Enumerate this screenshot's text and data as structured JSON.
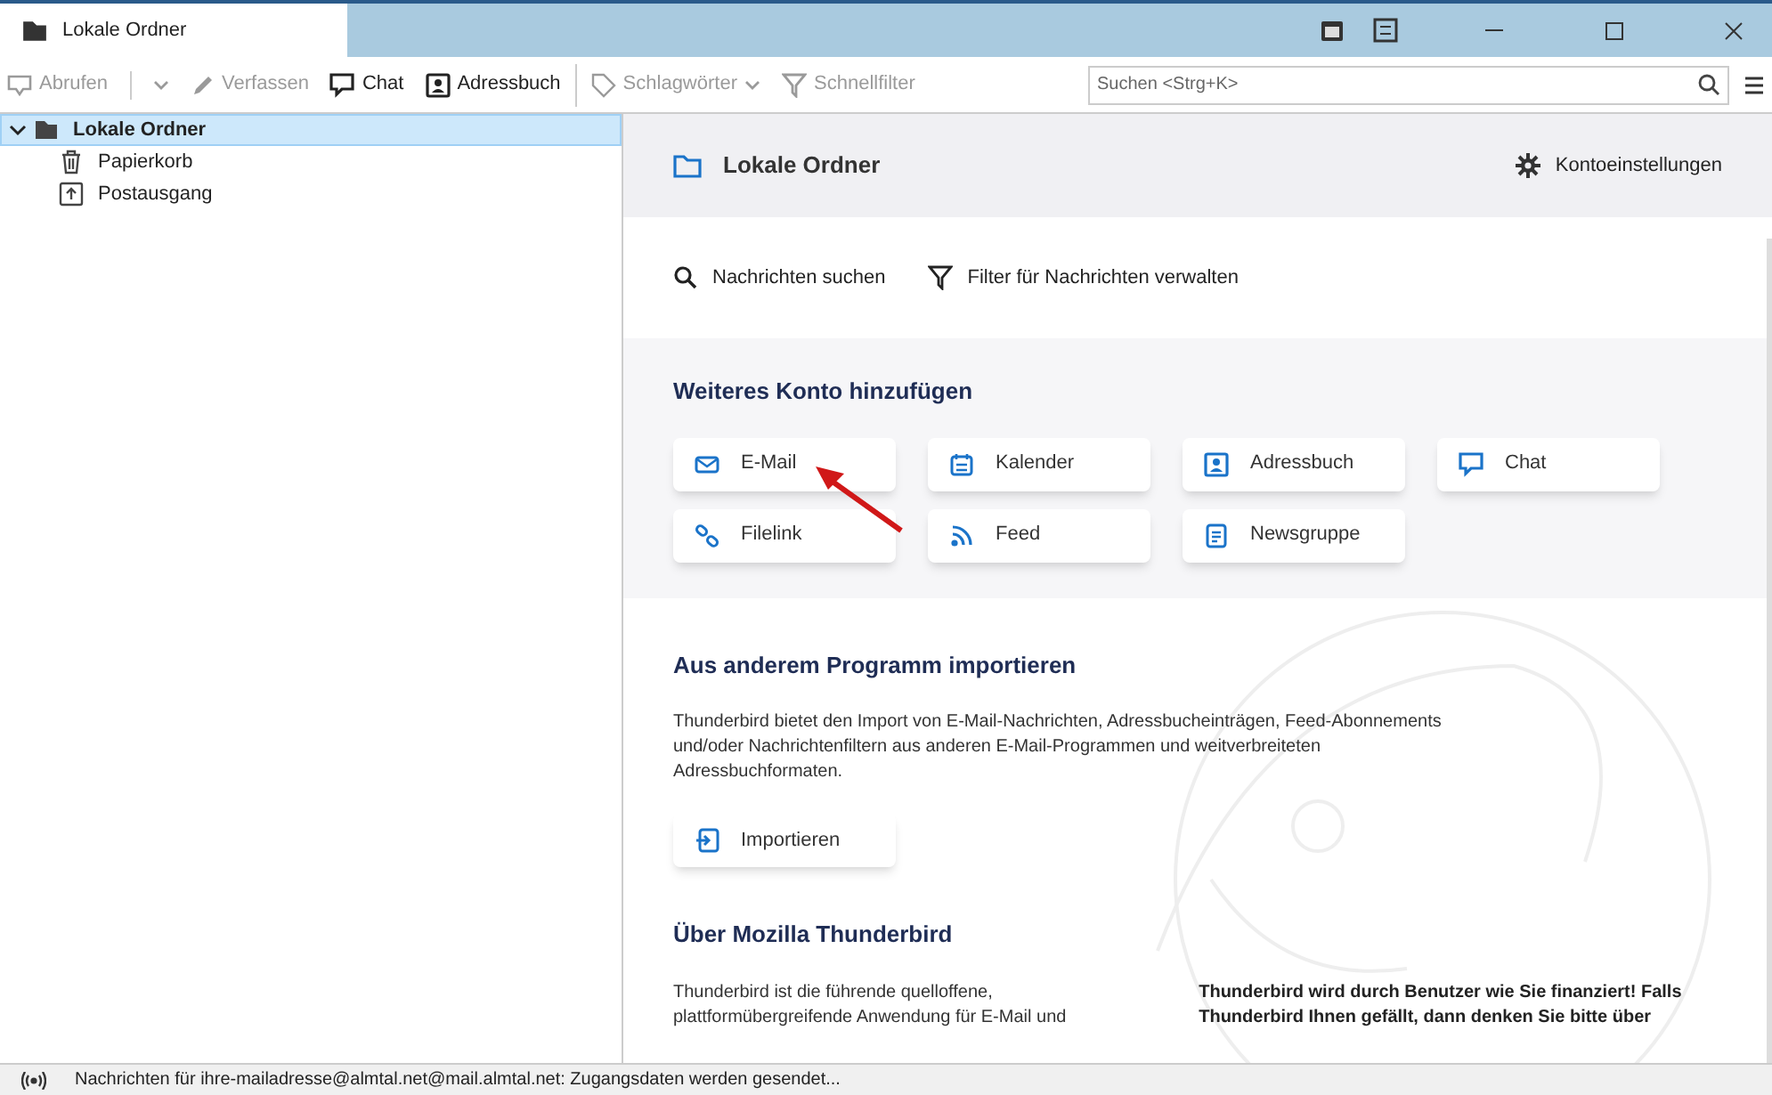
{
  "tab": {
    "title": "Lokale Ordner",
    "selected": true
  },
  "toolbar": {
    "left": [
      {
        "label": "Abrufen",
        "kind": "fetch",
        "disabled": true
      },
      {
        "label": "Verfassen",
        "kind": "compose",
        "disabled": true
      },
      {
        "label": "Chat",
        "kind": "chat",
        "disabled": false
      },
      {
        "label": "Adressbuch",
        "kind": "addressbook",
        "disabled": false
      }
    ],
    "right": [
      {
        "label": "Schlagwörter",
        "kind": "tags",
        "disabled": true
      },
      {
        "label": "Schnellfilter",
        "kind": "filter",
        "disabled": true
      }
    ],
    "search": {
      "placeholder": "Suchen <Strg+K>"
    }
  },
  "folders": [
    {
      "name": "Lokale Ordner",
      "kind": "root",
      "selected": true,
      "expanded": true,
      "children": [
        {
          "name": "Papierkorb",
          "kind": "trash",
          "selected": false
        },
        {
          "name": "Postausgang",
          "kind": "outbox",
          "selected": false
        }
      ]
    }
  ],
  "account": {
    "title": "Lokale Ordner",
    "settings": "Kontoeinstellungen",
    "actions": [
      {
        "label": "Nachrichten suchen",
        "kind": "search"
      },
      {
        "label": "Filter für Nachrichten verwalten",
        "kind": "filter"
      }
    ],
    "add_heading": "Weiteres Konto hinzufügen",
    "add_buttons": [
      {
        "label": "E-Mail",
        "kind": "mail"
      },
      {
        "label": "Kalender",
        "kind": "calendar"
      },
      {
        "label": "Adressbuch",
        "kind": "addressbook"
      },
      {
        "label": "Chat",
        "kind": "chat"
      },
      {
        "label": "Filelink",
        "kind": "link"
      },
      {
        "label": "Feed",
        "kind": "feed"
      },
      {
        "label": "Newsgruppe",
        "kind": "news"
      }
    ],
    "import_heading": "Aus anderem Programm importieren",
    "import_text": "Thunderbird bietet den Import von E-Mail-Nachrichten, Adressbucheinträgen, Feed-Abonnements und/oder Nachrichtenfiltern aus anderen E-Mail-Programmen und weitverbreiteten Adressbuchformaten.",
    "import_button": "Importieren",
    "about_heading": "Über Mozilla Thunderbird",
    "about_left": "Thunderbird ist die führende quelloffene, plattformübergreifende Anwendung für E-Mail und",
    "about_right": "Thunderbird wird durch Benutzer wie Sie finanziert! Falls Thunderbird Ihnen gefällt, dann denken Sie bitte über"
  },
  "status_bar": "Nachrichten für ihre-mailadresse@almtal.net@mail.almtal.net: Zugangsdaten werden gesendet..."
}
